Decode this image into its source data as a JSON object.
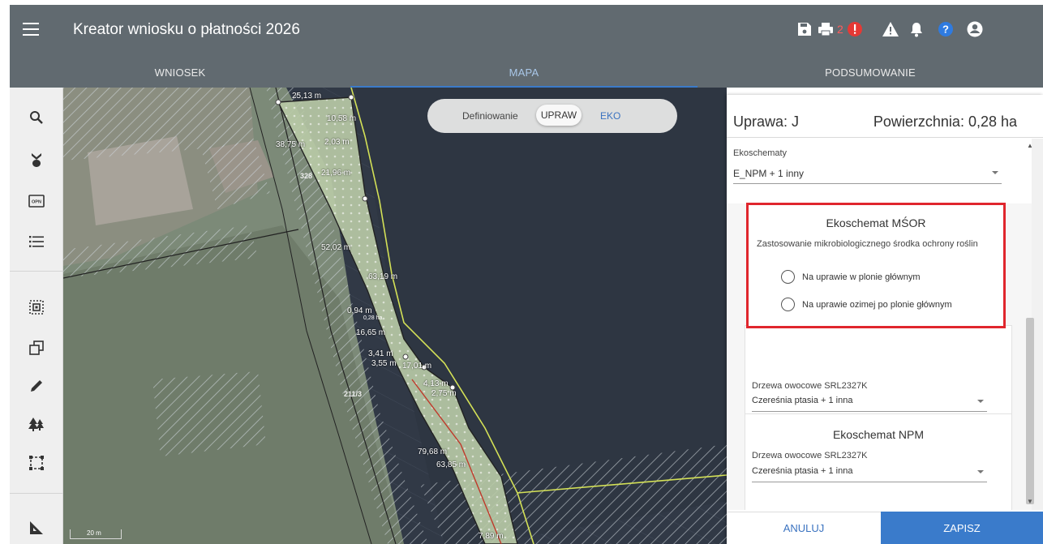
{
  "app": {
    "title": "Kreator wniosku o płatności 2026"
  },
  "toolbar": {
    "error_count": "2",
    "icons": [
      "save-icon",
      "print-icon",
      "error-icon",
      "warning-icon",
      "bell-icon",
      "help-icon",
      "account-icon"
    ]
  },
  "tabs": [
    {
      "label": "WNIOSEK",
      "active": false
    },
    {
      "label": "MAPA",
      "active": true
    },
    {
      "label": "PODSUMOWANIE",
      "active": false
    }
  ],
  "sidebar": {
    "icons": [
      "search-icon",
      "point-marker-icon",
      "orthophoto-icon",
      "list-icon",
      "select-area-icon",
      "copy-icon",
      "pencil-icon",
      "trees-icon",
      "rectangle-select-icon",
      "measure-icon"
    ]
  },
  "map": {
    "scale_label": "20 m",
    "parcel_labels": [
      "328",
      "211/3"
    ],
    "edge_labels": [
      "25,13 m",
      "10,58 m",
      "38,75 m",
      "2,03 m",
      "21,96 m",
      "52,02 m",
      "63,19 m",
      "0,94 m",
      "16,65 m",
      "3,41 m",
      "3,55 m",
      "17,01 m",
      "4,13 m",
      "2,75 m",
      "79,68 m",
      "63,85 m",
      "7,89 m"
    ],
    "area_label": "0,28 ha",
    "definition": {
      "label": "Definiowanie",
      "option_active": "UPRAW",
      "option_other": "EKO"
    }
  },
  "panel": {
    "crop": "Uprawa: J",
    "area": "Powierzchnia: 0,28 ha",
    "ecoschemes_label": "Ekoschematy",
    "ecoschemes_value": "E_NPM + 1 inny",
    "msor": {
      "title": "Ekoschemat MŚOR",
      "question": "Zastosowanie mikrobiologicznego środka ochrony roślin",
      "options": [
        "Na uprawie w plonie głównym",
        "Na uprawie ozimej po plonie głównym"
      ]
    },
    "trees_block": {
      "label": "Drzewa owocowe SRL2327K",
      "value": "Czereśnia ptasia + 1 inna"
    },
    "npm": {
      "title": "Ekoschemat NPM",
      "label": "Drzewa owocowe SRL2327K",
      "value": "Czereśnia ptasia + 1 inna"
    },
    "cancel_label": "ANULUJ",
    "save_label": "ZAPISZ"
  },
  "colors": {
    "appbar": "#616a70",
    "accent": "#3a7bcb",
    "highlight": "#e0262d",
    "error": "#e53935"
  }
}
